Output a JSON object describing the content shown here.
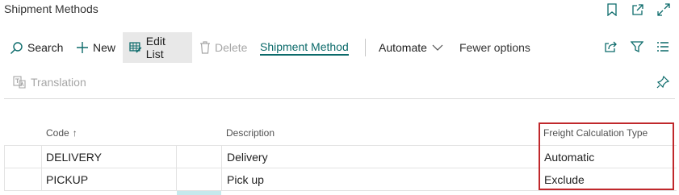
{
  "page": {
    "title": "Shipment Methods"
  },
  "actions": {
    "search": "Search",
    "new": "New",
    "edit_list": "Edit List",
    "delete": "Delete",
    "shipment_method": "Shipment Method",
    "automate": "Automate",
    "fewer_options": "Fewer options"
  },
  "subactions": {
    "translation": "Translation"
  },
  "table": {
    "columns": {
      "code": "Code",
      "description": "Description",
      "freight": "Freight Calculation Type"
    },
    "sort_indicator": "↑",
    "rows": [
      {
        "code": "DELIVERY",
        "description": "Delivery",
        "freight": "Automatic"
      },
      {
        "code": "PICKUP",
        "description": "Pick up",
        "freight": "Exclude"
      }
    ]
  },
  "colors": {
    "accent": "#0b6a6a",
    "highlight_border": "#c0282c"
  }
}
